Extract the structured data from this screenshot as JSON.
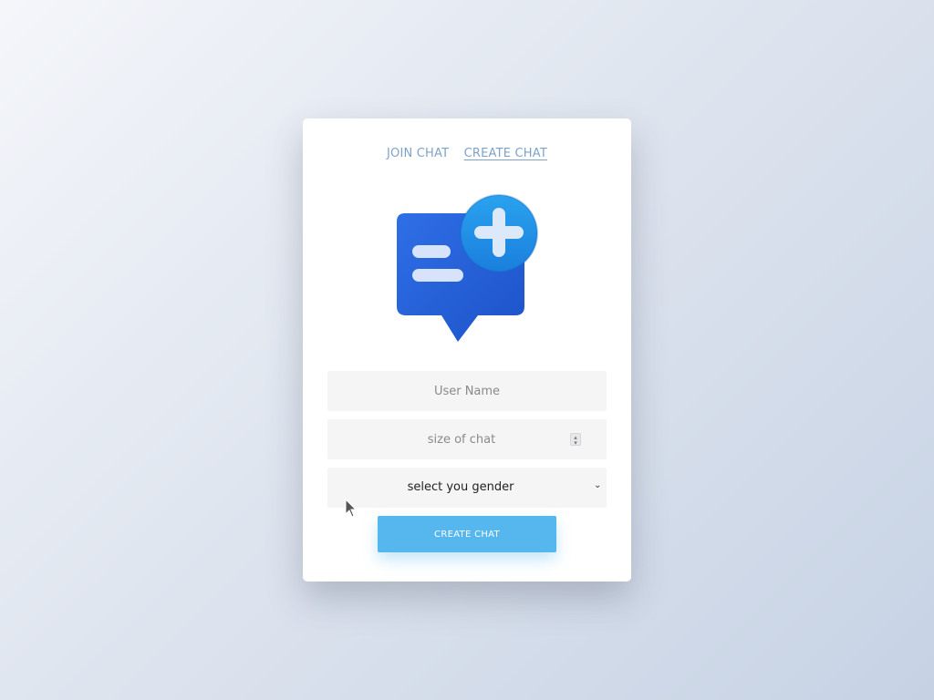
{
  "tabs": [
    {
      "label": "JOIN CHAT",
      "active": false
    },
    {
      "label": "CREATE CHAT",
      "active": true
    }
  ],
  "logo": {
    "icon": "chat-bubble-plus-icon",
    "bubble_color": "#2563d8",
    "badge_color": "#1e88e5"
  },
  "form": {
    "username_placeholder": "User Name",
    "size_placeholder": "size of chat",
    "gender_selected": "select you gender"
  },
  "submit_label": "CREATE CHAT",
  "colors": {
    "accent": "#55b7ee",
    "tab_text": "#7fa3c7",
    "field_bg": "#f5f5f5"
  }
}
